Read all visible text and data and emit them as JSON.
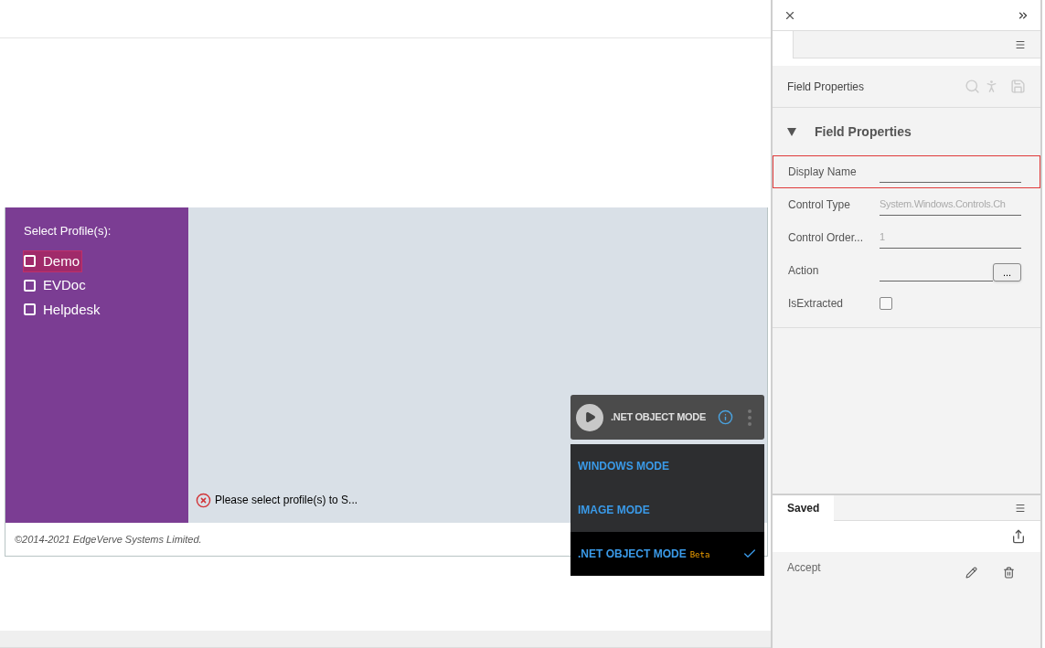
{
  "profiles": {
    "title": "Select Profile(s):",
    "items": [
      {
        "label": "Demo",
        "checked": false,
        "focused": true
      },
      {
        "label": "EVDoc",
        "checked": false,
        "focused": false
      },
      {
        "label": "Helpdesk",
        "checked": false,
        "focused": false
      }
    ]
  },
  "error_message": "Please select profile(s) to S...",
  "footer": "©2014-2021 EdgeVerve Systems Limited.",
  "mode_widget": {
    "current": ".NET OBJECT MODE",
    "options": [
      {
        "label": "WINDOWS MODE",
        "selected": false
      },
      {
        "label": "IMAGE MODE",
        "selected": false
      },
      {
        "label": ".NET OBJECT MODE",
        "badge": "Beta",
        "selected": true
      }
    ]
  },
  "panel": {
    "toolbar_title": "Field Properties",
    "section_title": "Field Properties",
    "expanded": true,
    "properties": [
      {
        "kind": "text",
        "label": "Display Name",
        "selected": true
      },
      {
        "kind": "text",
        "label": "Control Type",
        "value": "System.Windows.Controls.Ch",
        "selected": false
      },
      {
        "kind": "text",
        "label": "Control Order...",
        "value": "1",
        "selected": false
      },
      {
        "kind": "button",
        "label": "Action",
        "button": "...",
        "selected": false
      },
      {
        "kind": "checkbox",
        "label": "IsExtracted",
        "checked": false,
        "selected": false
      }
    ]
  },
  "saved": {
    "tab": "Saved",
    "items": [
      {
        "label": "Accept"
      }
    ]
  }
}
